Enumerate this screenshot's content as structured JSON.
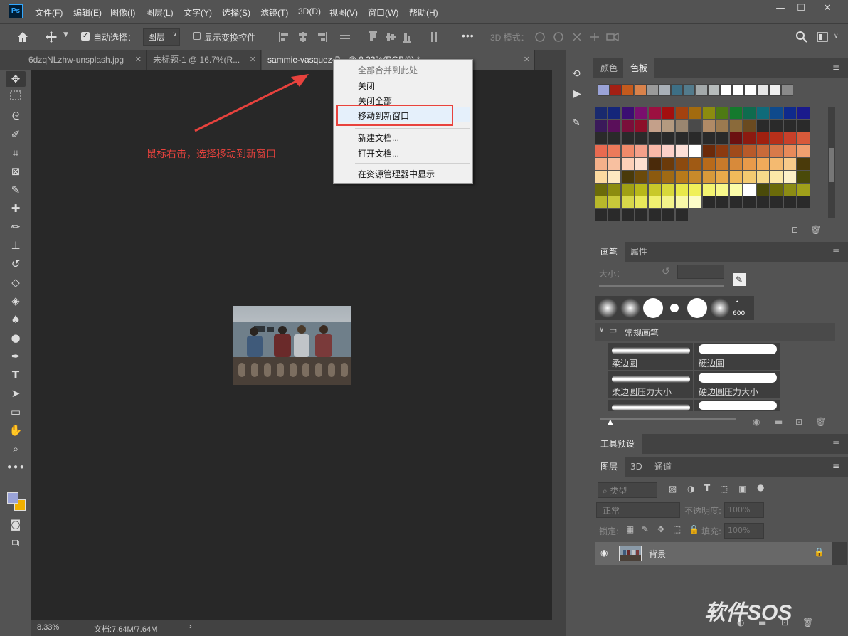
{
  "app": {
    "logo": "Ps"
  },
  "menu": [
    "文件(F)",
    "编辑(E)",
    "图像(I)",
    "图层(L)",
    "文字(Y)",
    "选择(S)",
    "滤镜(T)",
    "3D(D)",
    "视图(V)",
    "窗口(W)",
    "帮助(H)"
  ],
  "window_controls": {
    "minimize": "—",
    "maximize": "☐",
    "close": "✕"
  },
  "options": {
    "auto_select_label": "自动选择：",
    "auto_select_value": "图层",
    "transform_label": "显示变换控件",
    "mode3d_label": "3D 模式：",
    "more": "•••"
  },
  "tabs": [
    {
      "label": "6dzqNLzhw-unsplash.jpg",
      "close": "✕"
    },
    {
      "label": "未标题-1 @ 16.7%(R...",
      "close": "✕"
    },
    {
      "label": "sammie-vasquez-B...@ 8.33%(RGB/8) *",
      "close": "✕"
    }
  ],
  "tabs_overflow": "»",
  "context_menu": {
    "items": [
      "全部合并到此处",
      "关闭",
      "关闭全部",
      "移动到新窗口",
      "新建文档...",
      "打开文档...",
      "在资源管理器中显示"
    ],
    "highlighted": "移动到新窗口"
  },
  "annotation": {
    "text": "鼠标右击，选择移动到新窗口",
    "color": "#e8423d"
  },
  "status": {
    "zoom": "8.33%",
    "doc": "文档:7.64M/7.64M",
    "arrow": "›"
  },
  "swatches_panel": {
    "tabs": [
      "颜色",
      "色板"
    ],
    "active": "色板",
    "recent": [
      "#9aa3d8",
      "#a31f14",
      "#c45a1d",
      "#d9824b",
      "#9a9a9a",
      "#a9b0b8",
      "#3d6f85",
      "#537b8c",
      "#a3a9aa",
      "#b7bcbc",
      "#ffffff",
      "#ffffff",
      "#ffffff",
      "#e6e6e6",
      "#f0f0f0",
      "#8a8a8a"
    ],
    "grid_rows": [
      [
        "#1a2a6e",
        "#14267a",
        "#3b0e72",
        "#7a0f6e",
        "#9c1040",
        "#a30f0f",
        "#a3420f",
        "#a36b0f",
        "#8c8c0f",
        "#4e7a14",
        "#147a2d",
        "#0f6b4e",
        "#0f6b7a",
        "#0f4a8c",
        "#0f2a8c",
        "#1a1a8c"
      ],
      [
        "#3a1a5a",
        "#5a0f5a",
        "#7a0f3a",
        "#8c0f2a",
        "#c4a08a",
        "#b49a80",
        "#9a8670",
        "#4a4a4a",
        "#b08a66",
        "#9c7a50",
        "#8a6a3a",
        "#6a4a20",
        "#2a2a2a",
        "#2a2a2a",
        "#2a2a2a",
        "#2a2a2a"
      ],
      [
        "#2a2a2a",
        "#2a2a2a",
        "#2a2a2a",
        "#2a2a2a",
        "#2a2a2a",
        "#2a2a2a",
        "#2a2a2a",
        "#2a2a2a",
        "#2a2a2a",
        "#2a2a2a",
        "#6b1010",
        "#8c1a10",
        "#a0200f",
        "#b8301a",
        "#c8402a",
        "#d85a3a"
      ],
      [
        "#e86a50",
        "#ec7a5a",
        "#f08a6a",
        "#f4a08a",
        "#f8b8a8",
        "#fcd0c8",
        "#fde0d8",
        "#ffffff",
        "#6b2a0a",
        "#8c3a10",
        "#a04a1a",
        "#b85a2a",
        "#c86a3a",
        "#d87a4a",
        "#e88a5a",
        "#f0a070"
      ],
      [
        "#f4b08a",
        "#f8c0a0",
        "#fcd0b8",
        "#fde0d0",
        "#4a2a0a",
        "#6b3a0a",
        "#8c4a0f",
        "#a05a14",
        "#b86a1a",
        "#c87a2a",
        "#d88a3a",
        "#e89a4a",
        "#f0aa5a",
        "#f4ba70",
        "#f8ca8a",
        "#4a3a0a"
      ],
      [
        "#fcdaa0",
        "#fde8c0",
        "#4a3a0a",
        "#6b4a0a",
        "#8c5a0f",
        "#a06a14",
        "#b87a1a",
        "#c88a2a",
        "#d89a3a",
        "#e8aa4a",
        "#f0ba5a",
        "#f4ca70",
        "#f8da8a",
        "#fce8a8",
        "#fdf0c8",
        "#4a4a0a"
      ],
      [
        "#6b6b0a",
        "#8c8c0f",
        "#a0a014",
        "#b8b81a",
        "#c8c82a",
        "#d8d83a",
        "#e8e84a",
        "#f0f05a",
        "#f4f470",
        "#f8f88a",
        "#fcfca8",
        "#ffffff",
        "#4a4a0a",
        "#6b6b0a",
        "#8c8c14",
        "#a0a01a"
      ],
      [
        "#b8b82a",
        "#c8c83a",
        "#d8d84a",
        "#e8e85a",
        "#f0f070",
        "#f4f48a",
        "#f8f8a8",
        "#fcfcc8",
        "#2a2a2a",
        "#2a2a2a",
        "#2a2a2a",
        "#2a2a2a",
        "#2a2a2a",
        "#2a2a2a",
        "#2a2a2a",
        "#2a2a2a"
      ],
      [
        "#2a2a2a",
        "#2a2a2a",
        "#2a2a2a",
        "#2a2a2a",
        "#2a2a2a",
        "#2a2a2a",
        "#2a2a2a"
      ]
    ]
  },
  "brush_panel": {
    "tabs": [
      "画笔",
      "属性"
    ],
    "size_label": "大小：",
    "preset_size": "600",
    "group": "常规画笔",
    "brushes": [
      "柔边圆",
      "硬边圆",
      "柔边圆压力大小",
      "硬边圆压力大小"
    ]
  },
  "tool_presets": {
    "title": "工具预设"
  },
  "layers_panel": {
    "tabs": [
      "图层",
      "3D",
      "通道"
    ],
    "filter_label": "类型",
    "blend_mode": "正常",
    "opacity_label": "不透明度:",
    "opacity_value": "100%",
    "lock_label": "锁定:",
    "fill_label": "填充:",
    "fill_value": "100%",
    "layer_name": "背景"
  },
  "watermark": {
    "text": "软件SOS"
  },
  "icons": [
    "home-icon",
    "move-icon",
    "marquee-icon",
    "lasso-icon",
    "quick-select-icon",
    "crop-icon",
    "frame-icon",
    "eyedropper-icon",
    "healing-icon",
    "brush-icon",
    "stamp-icon",
    "history-brush-icon",
    "eraser-icon",
    "bucket-icon",
    "blur-icon",
    "dodge-icon",
    "pen-icon",
    "type-icon",
    "path-select-icon",
    "rectangle-icon",
    "hand-icon",
    "zoom-icon",
    "more-icon",
    "search-icon",
    "workspace-icon",
    "eye-icon",
    "lock-icon"
  ]
}
